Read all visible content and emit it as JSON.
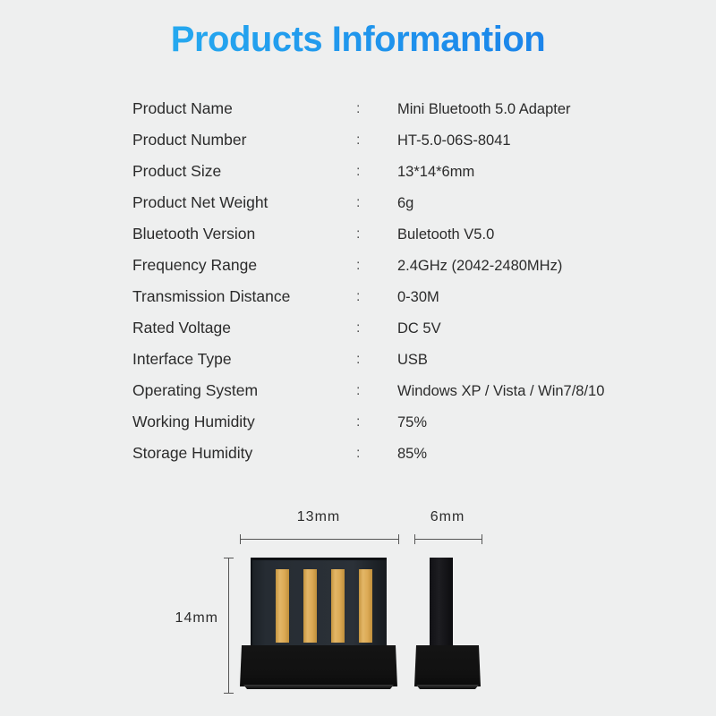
{
  "page": {
    "background_color": "#eeefef",
    "title": "Products Informantion",
    "title_gradient_from": "#2ab9f2",
    "title_gradient_to": "#1673e7"
  },
  "spec_table": {
    "separator": ":",
    "rows": [
      {
        "label": "Product Name",
        "value": "Mini Bluetooth 5.0 Adapter"
      },
      {
        "label": "Product Number",
        "value": "HT-5.0-06S-8041"
      },
      {
        "label": "Product Size",
        "value": "13*14*6mm"
      },
      {
        "label": "Product Net Weight",
        "value": "6g"
      },
      {
        "label": "Bluetooth Version",
        "value": "Buletooth V5.0"
      },
      {
        "label": "Frequency Range",
        "value": "2.4GHz (2042-2480MHz)"
      },
      {
        "label": "Transmission Distance",
        "value": "0-30M"
      },
      {
        "label": "Rated Voltage",
        "value": "DC 5V"
      },
      {
        "label": "Interface Type",
        "value": "USB"
      },
      {
        "label": "Operating System",
        "value": "Windows XP / Vista / Win7/8/10"
      },
      {
        "label": "Working Humidity",
        "value": "75%"
      },
      {
        "label": "Storage Humidity",
        "value": "85%"
      }
    ]
  },
  "diagram": {
    "width_label": "13mm",
    "depth_label": "6mm",
    "height_label": "14mm",
    "front_view_name": "usb-adapter-front-view",
    "side_view_name": "usb-adapter-side-view",
    "pin_count": 4,
    "pin_color": "#dcaa55",
    "plate_color": "#2b3138",
    "body_color": "#121212"
  }
}
